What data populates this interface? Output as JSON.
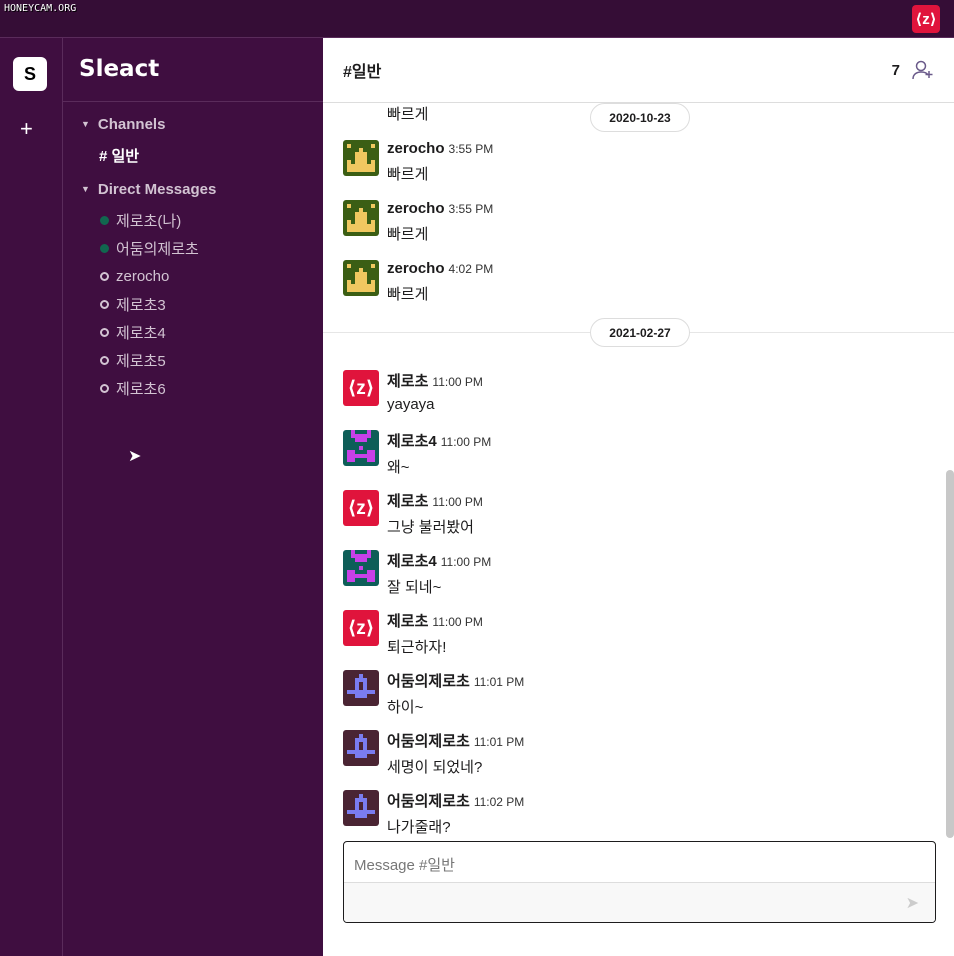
{
  "watermark": "HONEYCAM.ORG",
  "user_avatar": "⟨z⟩",
  "workspace": {
    "initial": "S",
    "add_label": "+"
  },
  "sidebar": {
    "title": "Sleact",
    "channels_label": "Channels",
    "channels": [
      {
        "label": "# 일반"
      }
    ],
    "dm_label": "Direct Messages",
    "dms": [
      {
        "label": "제로초(나)",
        "online": true
      },
      {
        "label": "어둠의제로초",
        "online": true
      },
      {
        "label": "zerocho",
        "online": false
      },
      {
        "label": "제로초3",
        "online": false
      },
      {
        "label": "제로초4",
        "online": false
      },
      {
        "label": "제로초5",
        "online": false
      },
      {
        "label": "제로초6",
        "online": false
      }
    ]
  },
  "header": {
    "title": "#일반",
    "member_count": "7",
    "add_user_icon": "user-plus-icon"
  },
  "colors": {
    "topbar": "#350d36",
    "sidebar": "#3f0e40",
    "online": "#11674f",
    "zlogo": "#e0143c"
  },
  "chat": {
    "partial_body": "빠르게",
    "sections": [
      {
        "date": "2020-10-23",
        "messages": [
          {
            "user": "zerocho",
            "time": "3:55 PM",
            "text": "빠르게",
            "avatar": "crown"
          },
          {
            "user": "zerocho",
            "time": "3:55 PM",
            "text": "빠르게",
            "avatar": "crown"
          },
          {
            "user": "zerocho",
            "time": "4:02 PM",
            "text": "빠르게",
            "avatar": "crown"
          }
        ]
      },
      {
        "date": "2021-02-27",
        "messages": [
          {
            "user": "제로초",
            "time": "11:00 PM",
            "text": "yayaya",
            "avatar": "zlogo"
          },
          {
            "user": "제로초4",
            "time": "11:00 PM",
            "text": "왜~",
            "avatar": "magenta"
          },
          {
            "user": "제로초",
            "time": "11:00 PM",
            "text": "그냥 불러봤어",
            "avatar": "zlogo"
          },
          {
            "user": "제로초4",
            "time": "11:00 PM",
            "text": "잘 되네~",
            "avatar": "magenta"
          },
          {
            "user": "제로초",
            "time": "11:00 PM",
            "text": "퇴근하자!",
            "avatar": "zlogo"
          },
          {
            "user": "어둠의제로초",
            "time": "11:01 PM",
            "text": "하이~",
            "avatar": "blue"
          },
          {
            "user": "어둠의제로초",
            "time": "11:01 PM",
            "text": "세명이 되었네?",
            "avatar": "blue"
          },
          {
            "user": "어둠의제로초",
            "time": "11:02 PM",
            "text": "나가줄래?",
            "avatar": "blue"
          }
        ]
      }
    ]
  },
  "input": {
    "placeholder": "Message #일반",
    "send_icon": "send-icon"
  }
}
